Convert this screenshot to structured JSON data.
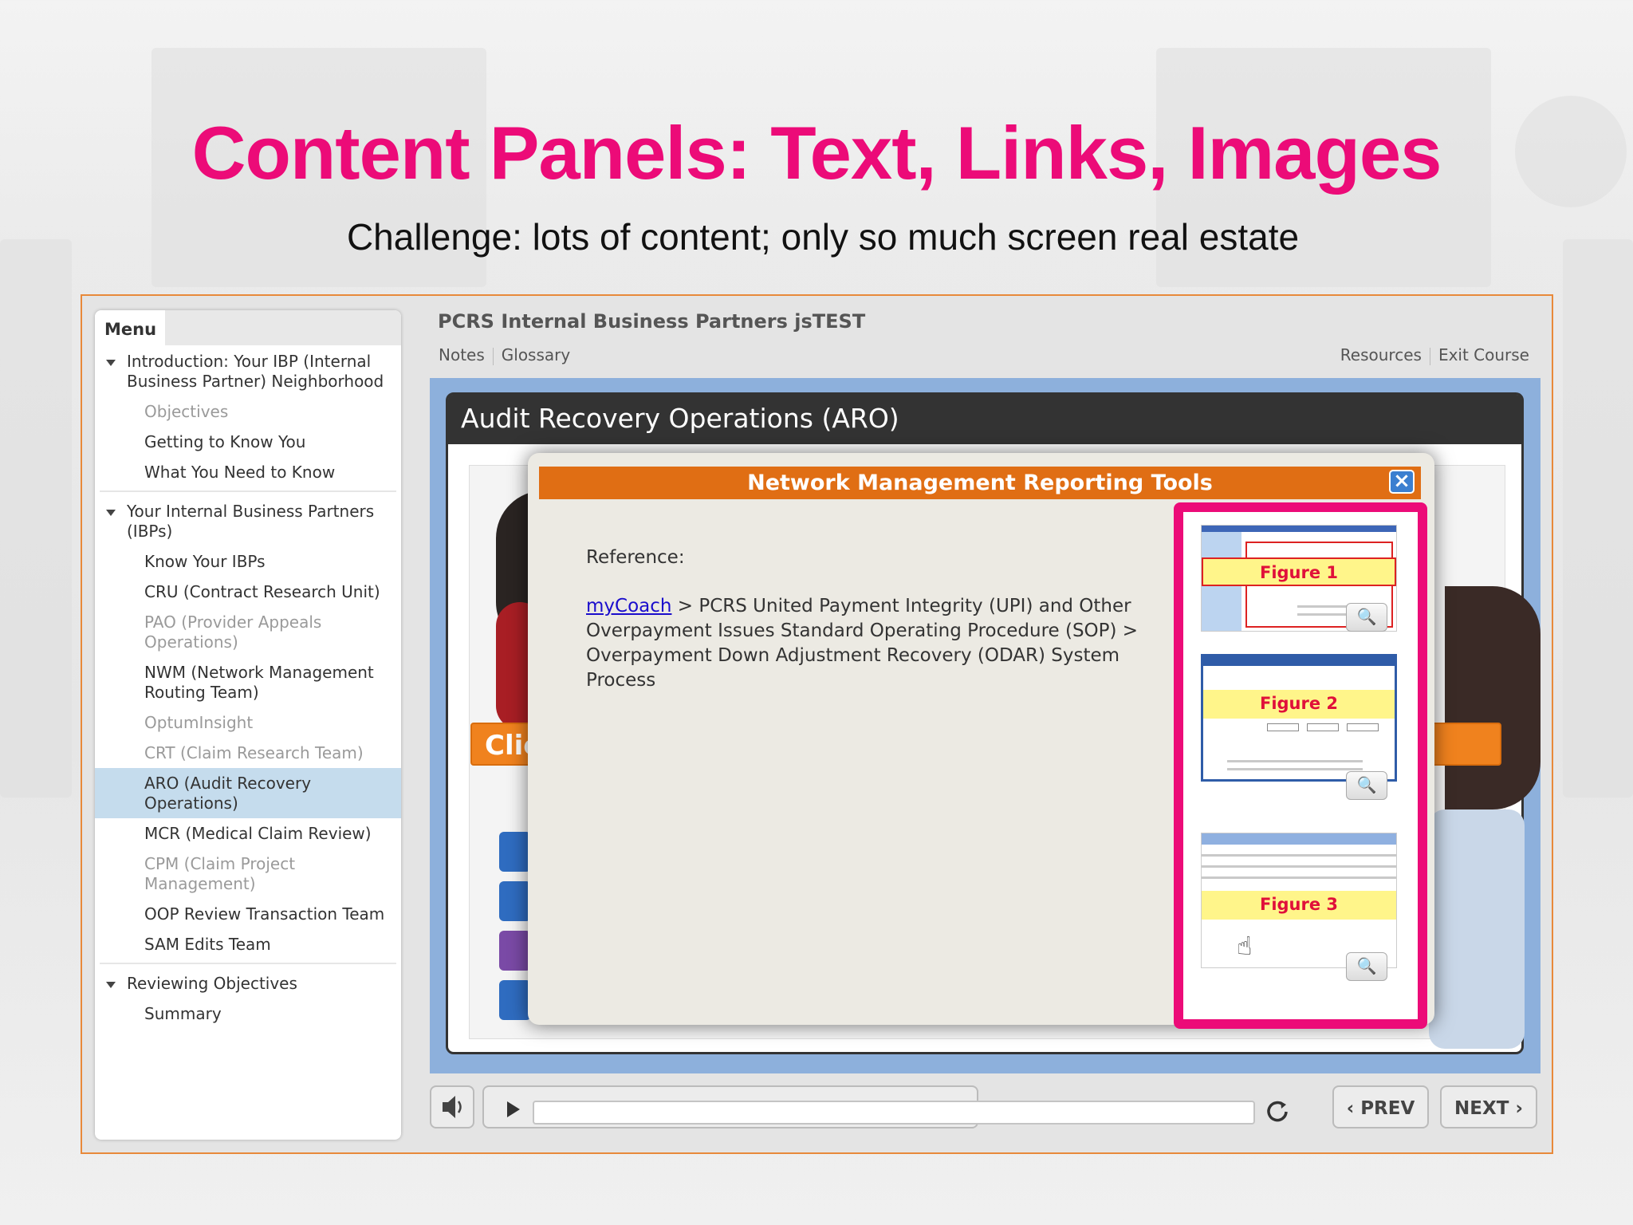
{
  "slide": {
    "title": "Content Panels: Text, Links, Images",
    "subtitle": "Challenge: lots of content; only so much screen real estate"
  },
  "player": {
    "course_title": "PCRS Internal Business Partners jsTEST",
    "links_left": [
      "Notes",
      "Glossary"
    ],
    "links_right": [
      "Resources",
      "Exit Course"
    ],
    "menu_tab": "Menu",
    "menu": {
      "sections": [
        {
          "label": "Introduction: Your IBP (Internal Business Partner) Neighborhood",
          "items": [
            {
              "label": "Objectives",
              "state": "dim"
            },
            {
              "label": "Getting to Know You",
              "state": "normal"
            },
            {
              "label": "What You Need to Know",
              "state": "normal"
            }
          ]
        },
        {
          "label": "Your Internal Business Partners (IBPs)",
          "items": [
            {
              "label": "Know Your IBPs",
              "state": "normal"
            },
            {
              "label": "CRU (Contract Research Unit)",
              "state": "normal"
            },
            {
              "label": "PAO (Provider Appeals Operations)",
              "state": "dim"
            },
            {
              "label": "NWM (Network Management Routing Team)",
              "state": "normal"
            },
            {
              "label": "OptumInsight",
              "state": "dim"
            },
            {
              "label": "CRT (Claim Research Team)",
              "state": "dim"
            },
            {
              "label": "ARO (Audit Recovery Operations)",
              "state": "active"
            },
            {
              "label": "MCR (Medical Claim Review)",
              "state": "normal"
            },
            {
              "label": "CPM (Claim Project Management)",
              "state": "dim"
            },
            {
              "label": "OOP Review Transaction Team",
              "state": "normal"
            },
            {
              "label": "SAM Edits Team",
              "state": "normal"
            }
          ]
        },
        {
          "label": "Reviewing Objectives",
          "items": [
            {
              "label": "Summary",
              "state": "normal"
            }
          ]
        }
      ]
    },
    "card_title": "Audit Recovery Operations (ARO)",
    "click_bar_text": "Clic",
    "controls": {
      "volume_icon": "speaker-icon",
      "play_icon": "play-icon",
      "replay_icon": "replay-icon",
      "prev_label": "PREV",
      "next_label": "NEXT"
    }
  },
  "modal": {
    "title": "Network Management Reporting Tools",
    "close_icon": "close-icon",
    "reference_label": "Reference:",
    "link_text": "myCoach",
    "path_text": " > PCRS United Payment Integrity (UPI) and Other Overpayment Issues Standard Operating Procedure (SOP) >  Overpayment Down Adjustment Recovery (ODAR) System Process",
    "figures": [
      "Figure 1",
      "Figure 2",
      "Figure 3"
    ],
    "zoom_icon": "magnifier-icon"
  },
  "colors": {
    "title_pink": "#ec0b78",
    "modal_header": "#e06e14",
    "highlight_border": "#ec0b78",
    "active_menu": "#c5dced",
    "stage_blue": "#8db0dc"
  }
}
